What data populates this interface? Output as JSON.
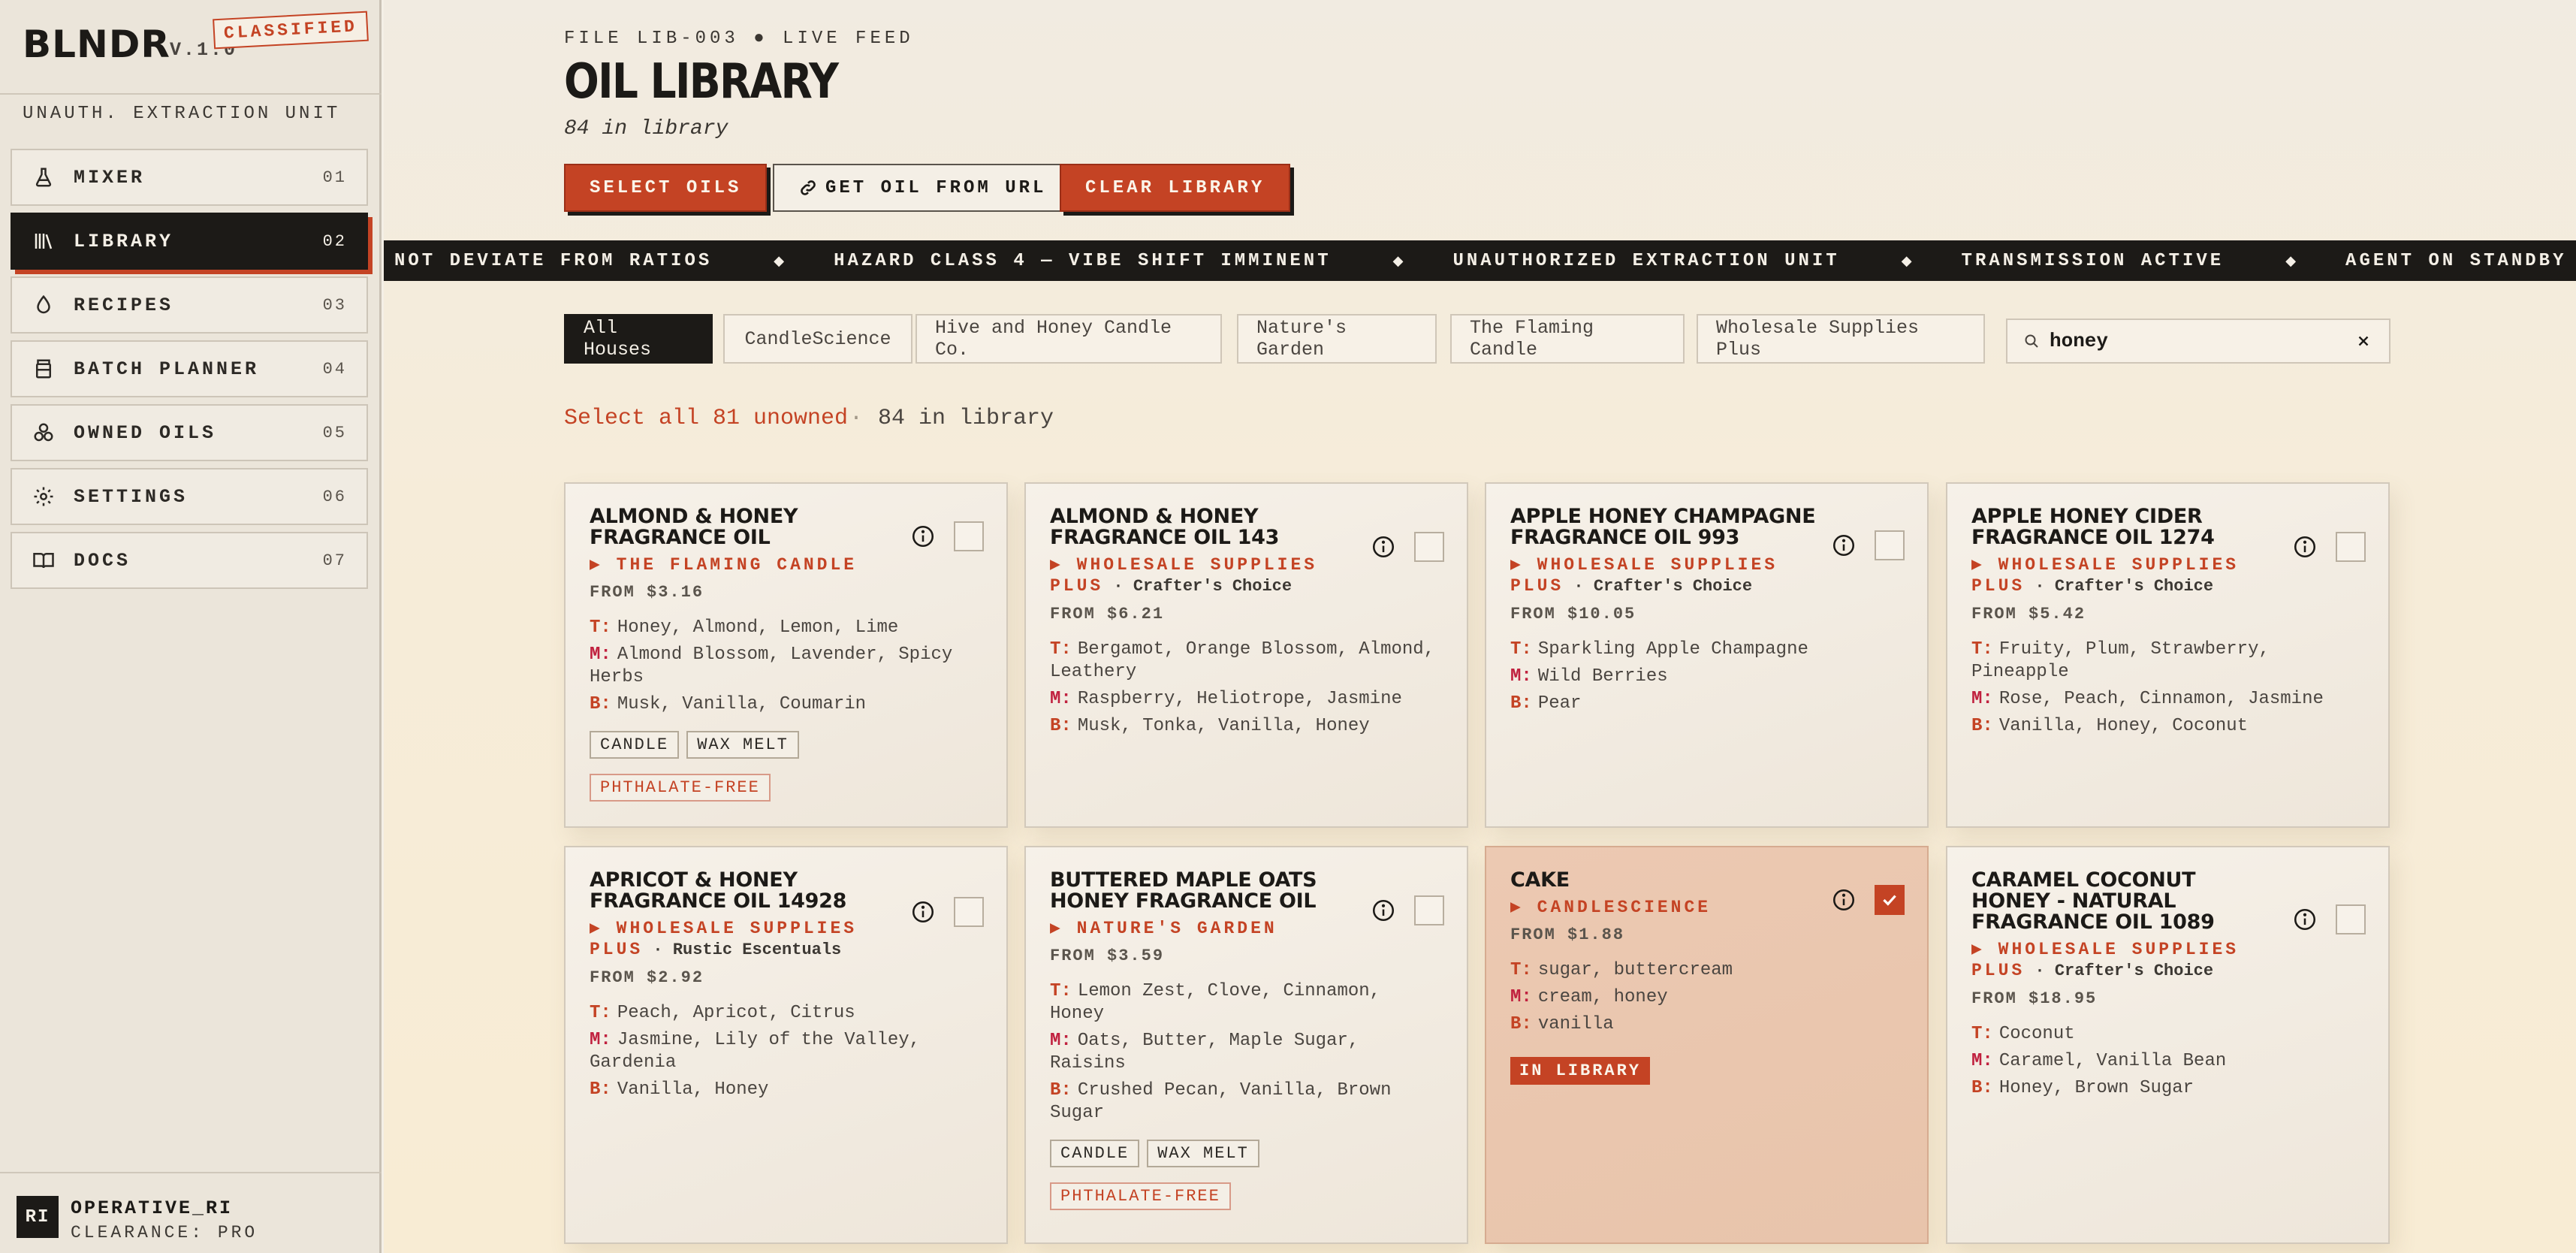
{
  "brand": {
    "logo": "BLNDR",
    "version": "V.1.0",
    "stamp": "CLASSIFIED"
  },
  "sidebar": {
    "unit_label": "UNAUTH. EXTRACTION UNIT",
    "items": [
      {
        "label": "MIXER",
        "num": "01",
        "icon": "flask-icon"
      },
      {
        "label": "LIBRARY",
        "num": "02",
        "icon": "library-icon"
      },
      {
        "label": "RECIPES",
        "num": "03",
        "icon": "drop-icon"
      },
      {
        "label": "BATCH PLANNER",
        "num": "04",
        "icon": "jar-icon"
      },
      {
        "label": "OWNED OILS",
        "num": "05",
        "icon": "cluster-icon"
      },
      {
        "label": "SETTINGS",
        "num": "06",
        "icon": "gear-icon"
      },
      {
        "label": "DOCS",
        "num": "07",
        "icon": "book-icon"
      }
    ],
    "active_index": 1
  },
  "user": {
    "initials": "RI",
    "name": "OPERATIVE_RI",
    "clearance": "CLEARANCE: PRO"
  },
  "header": {
    "file_meta": "FILE LIB-003 ● LIVE FEED",
    "title": "OIL LIBRARY",
    "count": "84 in library",
    "buttons": {
      "select": "SELECT OILS",
      "url": "GET OIL FROM URL",
      "clear": "CLEAR LIBRARY"
    }
  },
  "ticker": [
    "NOT DEVIATE FROM RATIOS",
    "HAZARD CLASS 4 — VIBE SHIFT IMMINENT",
    "UNAUTHORIZED EXTRACTION UNIT",
    "TRANSMISSION ACTIVE",
    "AGENT ON STANDBY"
  ],
  "ticker_sep": "◆",
  "filters": {
    "houses": [
      "All Houses",
      "CandleScience",
      "Hive and Honey Candle Co.",
      "Nature's Garden",
      "The Flaming Candle",
      "Wholesale Supplies Plus"
    ],
    "active": 0,
    "search_value": "honey",
    "select_all": "Select all 81 unowned",
    "dot": "·",
    "count": "84 in library"
  },
  "card_keys": {
    "top": "T:",
    "mid": "M:",
    "base": "B:"
  },
  "in_library_label": "IN LIBRARY",
  "cards": [
    {
      "title": "ALMOND & HONEY FRAGRANCE OIL",
      "house": "▶ THE FLAMING CANDLE",
      "sub": "",
      "price": "FROM $3.16",
      "top": "Honey, Almond, Lemon, Lime",
      "mid": "Almond Blossom, Lavender, Spicy Herbs",
      "base": "Musk, Vanilla, Coumarin",
      "tags": [
        "CANDLE",
        "WAX MELT"
      ],
      "red_tags": [
        "PHTHALATE-FREE"
      ],
      "selected": false
    },
    {
      "title": "ALMOND & HONEY FRAGRANCE OIL 143",
      "house": "▶ WHOLESALE SUPPLIES PLUS",
      "sub": "Crafter's Choice",
      "price": "FROM $6.21",
      "top": "Bergamot, Orange Blossom, Almond, Leathery",
      "mid": "Raspberry, Heliotrope, Jasmine",
      "base": "Musk, Tonka, Vanilla, Honey",
      "tags": [],
      "red_tags": [],
      "selected": false
    },
    {
      "title": "APPLE HONEY CHAMPAGNE FRAGRANCE OIL 993",
      "house": "▶ WHOLESALE SUPPLIES PLUS",
      "sub": "Crafter's Choice",
      "price": "FROM $10.05",
      "top": "Sparkling Apple Champagne",
      "mid": "Wild Berries",
      "base": "Pear",
      "tags": [],
      "red_tags": [],
      "selected": false
    },
    {
      "title": "APPLE HONEY CIDER FRAGRANCE OIL 1274",
      "house": "▶ WHOLESALE SUPPLIES PLUS",
      "sub": "Crafter's Choice",
      "price": "FROM $5.42",
      "top": "Fruity, Plum, Strawberry, Pineapple",
      "mid": "Rose, Peach, Cinnamon, Jasmine",
      "base": "Vanilla, Honey, Coconut",
      "tags": [],
      "red_tags": [],
      "selected": false
    },
    {
      "title": "APRICOT & HONEY FRAGRANCE OIL 14928",
      "house": "▶ WHOLESALE SUPPLIES PLUS",
      "sub": "Rustic Escentuals",
      "price": "FROM $2.92",
      "top": "Peach, Apricot, Citrus",
      "mid": "Jasmine, Lily of the Valley, Gardenia",
      "base": "Vanilla, Honey",
      "tags": [],
      "red_tags": [],
      "selected": false
    },
    {
      "title": "BUTTERED MAPLE OATS HONEY FRAGRANCE OIL",
      "house": "▶ NATURE'S GARDEN",
      "sub": "",
      "price": "FROM $3.59",
      "top": "Lemon Zest, Clove, Cinnamon, Honey",
      "mid": "Oats, Butter, Maple Sugar, Raisins",
      "base": "Crushed Pecan, Vanilla, Brown Sugar",
      "tags": [
        "CANDLE",
        "WAX MELT"
      ],
      "red_tags": [
        "PHTHALATE-FREE"
      ],
      "selected": false
    },
    {
      "title": "CAKE",
      "house": "▶ CANDLESCIENCE",
      "sub": "",
      "price": "FROM $1.88",
      "top": "sugar, buttercream",
      "mid": "cream, honey",
      "base": "vanilla",
      "tags": [],
      "red_tags": [],
      "selected": true
    },
    {
      "title": "CARAMEL COCONUT HONEY - NATURAL FRAGRANCE OIL 1089",
      "house": "▶ WHOLESALE SUPPLIES PLUS",
      "sub": "Crafter's Choice",
      "price": "FROM $18.95",
      "top": "Coconut",
      "mid": "Caramel, Vanilla Bean",
      "base": "Honey, Brown Sugar",
      "tags": [],
      "red_tags": [],
      "selected": false
    }
  ]
}
